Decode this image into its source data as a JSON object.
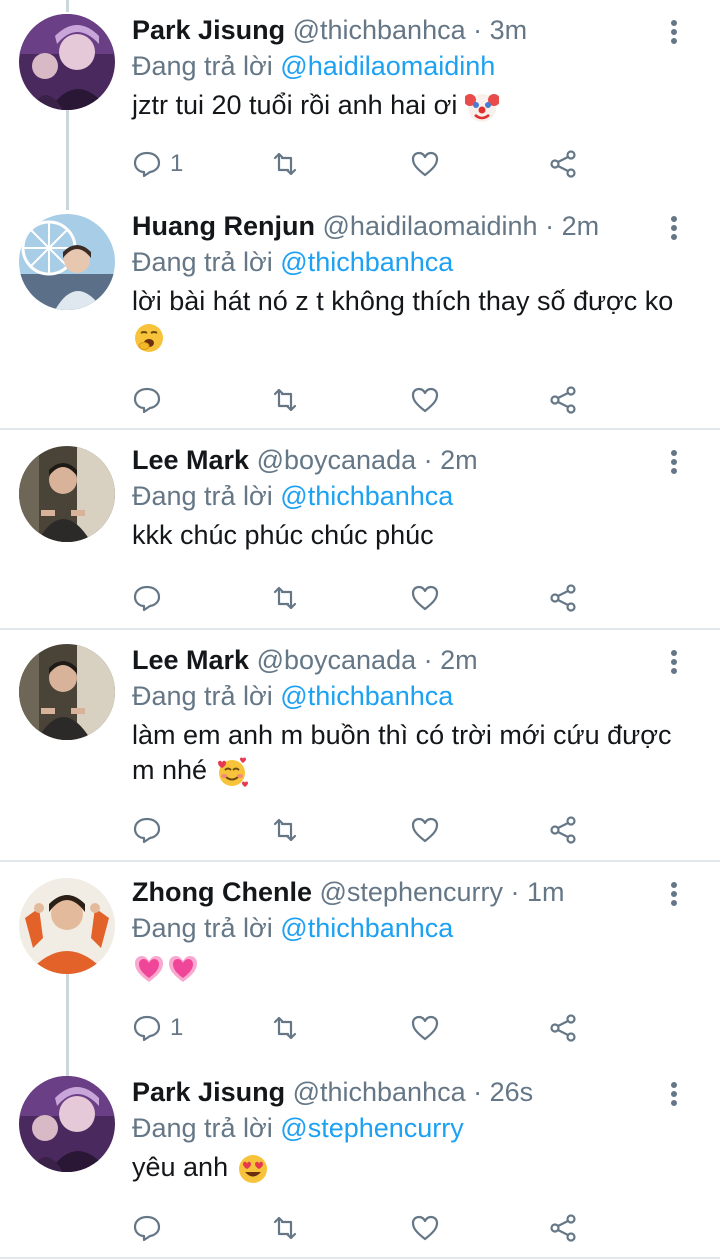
{
  "tweets": [
    {
      "name": "Park Jisung",
      "handle": "@thichbanhca",
      "dot": "·",
      "time": "3m",
      "reply_prefix": "Đang trả lời",
      "reply_to": "@haidilaomaidinh",
      "text": "jztr tui 20 tuổi rồi anh hai ơi",
      "emoji": "clown-face",
      "reply_count": "1",
      "avatar": "purple-portrait"
    },
    {
      "name": "Huang Renjun",
      "handle": "@haidilaomaidinh",
      "dot": "·",
      "time": "2m",
      "reply_prefix": "Đang trả lời",
      "reply_to": "@thichbanhca",
      "text": "lời bài hát nó z t không thích thay số được ko",
      "emoji": "yawning-face",
      "reply_count": "",
      "avatar": "ferris-wheel-portrait"
    },
    {
      "name": "Lee Mark",
      "handle": "@boycanada",
      "dot": "·",
      "time": "2m",
      "reply_prefix": "Đang trả lời",
      "reply_to": "@thichbanhca",
      "text": "kkk chúc phúc chúc phúc",
      "emoji": "",
      "reply_count": "",
      "avatar": "dark-room-portrait"
    },
    {
      "name": "Lee Mark",
      "handle": "@boycanada",
      "dot": "·",
      "time": "2m",
      "reply_prefix": "Đang trả lời",
      "reply_to": "@thichbanhca",
      "text": "làm em anh m buồn thì có trời mới cứu được m nhé",
      "emoji": "smiling-face-with-hearts",
      "reply_count": "",
      "avatar": "dark-room-portrait"
    },
    {
      "name": "Zhong Chenle",
      "handle": "@stephencurry",
      "dot": "·",
      "time": "1m",
      "reply_prefix": "Đang trả lời",
      "reply_to": "@thichbanhca",
      "text": "",
      "emoji": "growing-hearts",
      "reply_count": "1",
      "avatar": "orange-sweater-portrait"
    },
    {
      "name": "Park Jisung",
      "handle": "@thichbanhca",
      "dot": "·",
      "time": "26s",
      "reply_prefix": "Đang trả lời",
      "reply_to": "@stephencurry",
      "text": "yêu anh",
      "emoji": "heart-eyes",
      "reply_count": "",
      "avatar": "purple-portrait"
    }
  ],
  "colors": {
    "link": "#1da1f2",
    "secondary": "#657786",
    "divider": "#e1e8ed",
    "thread_line": "#ccd6dd"
  }
}
